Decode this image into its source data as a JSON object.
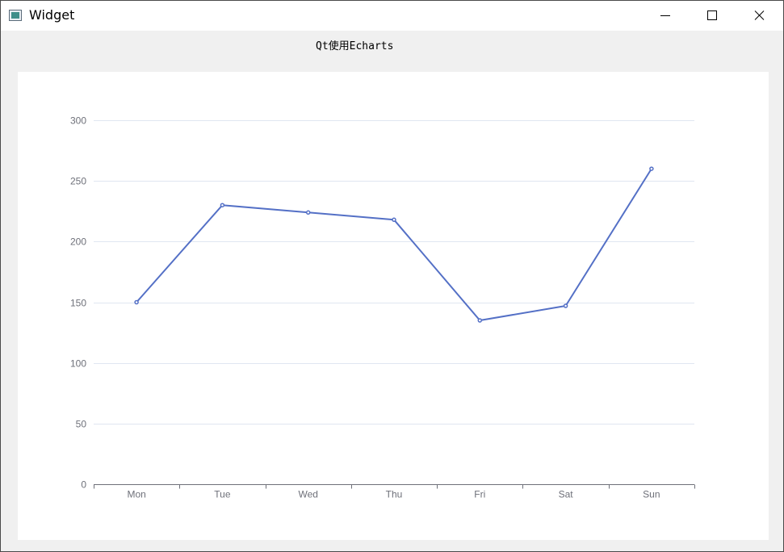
{
  "window": {
    "title": "Widget",
    "icon": "app-window-icon",
    "controls": {
      "minimize_icon": "minimize-icon",
      "maximize_icon": "maximize-icon",
      "close_icon": "close-icon"
    }
  },
  "caption": "Qt使用Echarts",
  "chart_data": {
    "type": "line",
    "categories": [
      "Mon",
      "Tue",
      "Wed",
      "Thu",
      "Fri",
      "Sat",
      "Sun"
    ],
    "series": [
      {
        "values": [
          150,
          230,
          224,
          218,
          135,
          147,
          260
        ],
        "color": "#5470c6"
      }
    ],
    "ylim": [
      0,
      300
    ],
    "yticks": [
      0,
      50,
      100,
      150,
      200,
      250,
      300
    ],
    "grid": true,
    "title": "",
    "xlabel": "",
    "ylabel": ""
  }
}
